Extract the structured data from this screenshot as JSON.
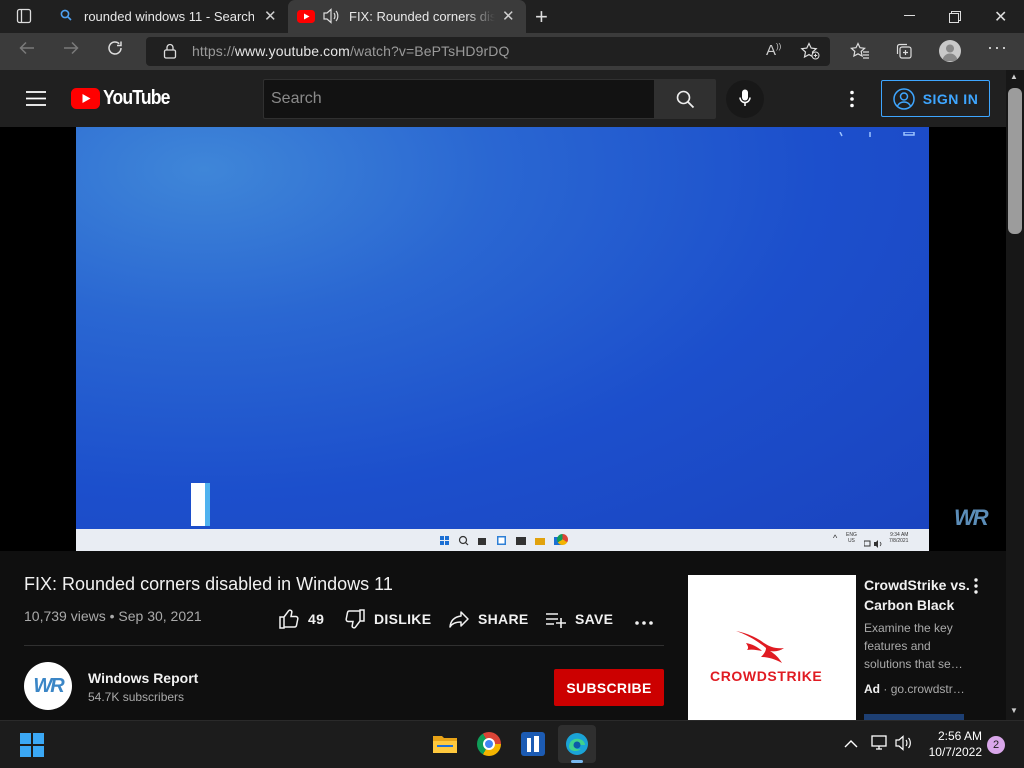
{
  "browser": {
    "tabs": [
      {
        "title": "rounded windows 11 - Search",
        "icon": "search-icon",
        "active": false
      },
      {
        "title": "FIX: Rounded corners disabled in Windows 11",
        "icon": "youtube-favicon",
        "audio": "speaker-icon",
        "active": true
      }
    ],
    "url_prefix": "https://",
    "url_domain": "www.youtube.com",
    "url_path": "/watch?v=BePTsHD9rDQ"
  },
  "youtube": {
    "logo_text": "YouTube",
    "search_placeholder": "Search",
    "signin_label": "SIGN IN"
  },
  "video": {
    "title": "FIX: Rounded corners disabled in Windows 11",
    "views": "10,739 views",
    "separator": "•",
    "date": "Sep 30, 2021",
    "like_count": "49",
    "dislike_label": "DISLIKE",
    "share_label": "SHARE",
    "save_label": "SAVE",
    "watermark": "WR",
    "inner_taskbar_lang": "ENG",
    "inner_taskbar_region": "US",
    "inner_taskbar_time": "9:34 AM",
    "inner_taskbar_date": "7/8/2021"
  },
  "channel": {
    "name": "Windows Report",
    "subscribers": "54.7K subscribers",
    "subscribe_label": "SUBSCRIBE",
    "avatar_text": "WR"
  },
  "ad": {
    "brand_text": "CROWDSTRIKE",
    "title": "CrowdStrike vs. Carbon Black",
    "description": "Examine the key features and solutions that se…",
    "badge": "Ad",
    "domain": "go.crowdstr…"
  },
  "taskbar": {
    "time": "2:56 AM",
    "date": "10/7/2022",
    "notification_count": "2"
  },
  "colors": {
    "accent_blue": "#3ea6ff",
    "subscribe_red": "#cc0000",
    "youtube_red": "#ff0000",
    "crowdstrike_red": "#e01b22"
  }
}
